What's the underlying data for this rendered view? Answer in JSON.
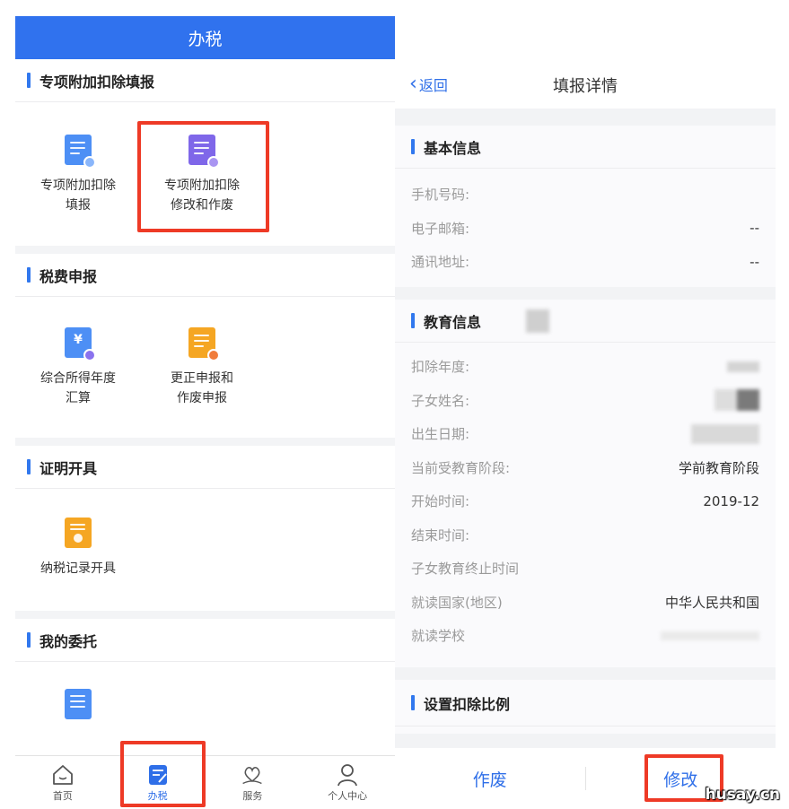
{
  "left": {
    "title": "办税",
    "sections": [
      {
        "title": "专项附加扣除填报",
        "items": [
          {
            "line1": "专项附加扣除",
            "line2": "填报",
            "icon": "edit-document-icon",
            "color": "#4d8ff5"
          },
          {
            "line1": "专项附加扣除",
            "line2": "修改和作废",
            "icon": "document-settings-icon",
            "color": "#7f67e9"
          }
        ]
      },
      {
        "title": "税费申报",
        "items": [
          {
            "line1": "综合所得年度",
            "line2": "汇算",
            "icon": "yuan-document-icon",
            "color": "#4d8ff5"
          },
          {
            "line1": "更正申报和",
            "line2": "作废申报",
            "icon": "document-cancel-icon",
            "color": "#f5a623"
          }
        ]
      },
      {
        "title": "证明开具",
        "items": [
          {
            "line1": "纳税记录开具",
            "line2": "",
            "icon": "certificate-icon",
            "color": "#f5a623"
          }
        ]
      },
      {
        "title": "我的委托",
        "items": [
          {
            "line1": "",
            "line2": "",
            "icon": "delegation-icon",
            "color": "#4d8ff5"
          }
        ]
      }
    ],
    "tabs": [
      {
        "label": "首页",
        "icon": "home-icon"
      },
      {
        "label": "办税",
        "icon": "tax-icon"
      },
      {
        "label": "服务",
        "icon": "heart-service-icon"
      },
      {
        "label": "个人中心",
        "icon": "person-icon"
      }
    ]
  },
  "right": {
    "back": "返回",
    "title": "填报详情",
    "basic": {
      "title": "基本信息",
      "rows": [
        {
          "k": "手机号码:",
          "v": ""
        },
        {
          "k": "电子邮箱:",
          "v": "--"
        },
        {
          "k": "通讯地址:",
          "v": "--"
        }
      ]
    },
    "edu": {
      "title": "教育信息",
      "rows": [
        {
          "k": "扣除年度:",
          "v": ""
        },
        {
          "k": "子女姓名:",
          "v": ""
        },
        {
          "k": "出生日期:",
          "v": ""
        },
        {
          "k": "当前受教育阶段:",
          "v": "学前教育阶段"
        },
        {
          "k": "开始时间:",
          "v": "2019-12"
        },
        {
          "k": "结束时间:",
          "v": ""
        },
        {
          "k": "子女教育终止时间",
          "v": ""
        },
        {
          "k": "就读国家(地区)",
          "v": "中华人民共和国"
        },
        {
          "k": "就读学校",
          "v": ""
        }
      ]
    },
    "ratio": {
      "title": "设置扣除比例"
    },
    "actions": {
      "void": "作废",
      "modify": "修改"
    }
  },
  "colors": {
    "brand_blue": "#3072ee",
    "highlight_red": "#ee3a26"
  },
  "watermark": "husay.cn"
}
